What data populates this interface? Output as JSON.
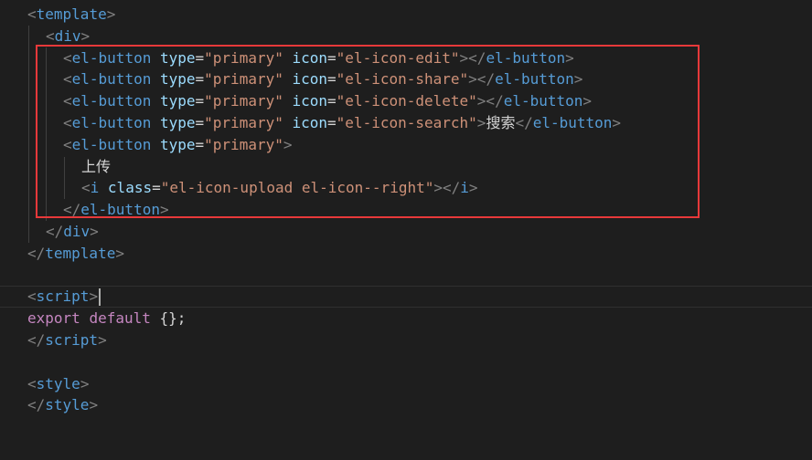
{
  "editor": {
    "lines": [
      {
        "tokens": [
          [
            "<",
            "b"
          ],
          [
            "template",
            "t"
          ],
          [
            ">",
            "b"
          ]
        ]
      },
      {
        "tokens": [
          [
            "<",
            "b"
          ],
          [
            "div",
            "t"
          ],
          [
            ">",
            "b"
          ]
        ]
      },
      {
        "tokens": [
          [
            "<",
            "b"
          ],
          [
            "el-button",
            "t"
          ],
          [
            " ",
            "x"
          ],
          [
            "type",
            "a"
          ],
          [
            "=",
            "e"
          ],
          [
            "\"primary\"",
            "s"
          ],
          [
            " ",
            "x"
          ],
          [
            "icon",
            "a"
          ],
          [
            "=",
            "e"
          ],
          [
            "\"el-icon-edit\"",
            "s"
          ],
          [
            "></",
            "b"
          ],
          [
            "el-button",
            "t"
          ],
          [
            ">",
            "b"
          ]
        ]
      },
      {
        "tokens": [
          [
            "<",
            "b"
          ],
          [
            "el-button",
            "t"
          ],
          [
            " ",
            "x"
          ],
          [
            "type",
            "a"
          ],
          [
            "=",
            "e"
          ],
          [
            "\"primary\"",
            "s"
          ],
          [
            " ",
            "x"
          ],
          [
            "icon",
            "a"
          ],
          [
            "=",
            "e"
          ],
          [
            "\"el-icon-share\"",
            "s"
          ],
          [
            "></",
            "b"
          ],
          [
            "el-button",
            "t"
          ],
          [
            ">",
            "b"
          ]
        ]
      },
      {
        "tokens": [
          [
            "<",
            "b"
          ],
          [
            "el-button",
            "t"
          ],
          [
            " ",
            "x"
          ],
          [
            "type",
            "a"
          ],
          [
            "=",
            "e"
          ],
          [
            "\"primary\"",
            "s"
          ],
          [
            " ",
            "x"
          ],
          [
            "icon",
            "a"
          ],
          [
            "=",
            "e"
          ],
          [
            "\"el-icon-delete\"",
            "s"
          ],
          [
            "></",
            "b"
          ],
          [
            "el-button",
            "t"
          ],
          [
            ">",
            "b"
          ]
        ]
      },
      {
        "tokens": [
          [
            "<",
            "b"
          ],
          [
            "el-button",
            "t"
          ],
          [
            " ",
            "x"
          ],
          [
            "type",
            "a"
          ],
          [
            "=",
            "e"
          ],
          [
            "\"primary\"",
            "s"
          ],
          [
            " ",
            "x"
          ],
          [
            "icon",
            "a"
          ],
          [
            "=",
            "e"
          ],
          [
            "\"el-icon-search\"",
            "s"
          ],
          [
            ">",
            "b"
          ],
          [
            "搜索",
            "x"
          ],
          [
            "</",
            "b"
          ],
          [
            "el-button",
            "t"
          ],
          [
            ">",
            "b"
          ]
        ]
      },
      {
        "tokens": [
          [
            "<",
            "b"
          ],
          [
            "el-button",
            "t"
          ],
          [
            " ",
            "x"
          ],
          [
            "type",
            "a"
          ],
          [
            "=",
            "e"
          ],
          [
            "\"primary\"",
            "s"
          ],
          [
            ">",
            "b"
          ]
        ]
      },
      {
        "tokens": [
          [
            "上传",
            "x"
          ]
        ]
      },
      {
        "tokens": [
          [
            "<",
            "b"
          ],
          [
            "i",
            "t"
          ],
          [
            " ",
            "x"
          ],
          [
            "class",
            "a"
          ],
          [
            "=",
            "e"
          ],
          [
            "\"el-icon-upload el-icon--right\"",
            "s"
          ],
          [
            "></",
            "b"
          ],
          [
            "i",
            "t"
          ],
          [
            ">",
            "b"
          ]
        ]
      },
      {
        "tokens": [
          [
            "</",
            "b"
          ],
          [
            "el-button",
            "t"
          ],
          [
            ">",
            "b"
          ]
        ]
      },
      {
        "tokens": [
          [
            "</",
            "b"
          ],
          [
            "div",
            "t"
          ],
          [
            ">",
            "b"
          ]
        ]
      },
      {
        "tokens": [
          [
            "</",
            "b"
          ],
          [
            "template",
            "t"
          ],
          [
            ">",
            "b"
          ]
        ]
      },
      {
        "tokens": []
      },
      {
        "tokens": [
          [
            "<",
            "b"
          ],
          [
            "script",
            "t"
          ],
          [
            ">",
            "b"
          ]
        ],
        "cursor": true
      },
      {
        "tokens": [
          [
            "export",
            "k"
          ],
          [
            " ",
            "x"
          ],
          [
            "default",
            "k"
          ],
          [
            " {};",
            "x"
          ]
        ]
      },
      {
        "tokens": [
          [
            "</",
            "b"
          ],
          [
            "script",
            "t"
          ],
          [
            ">",
            "b"
          ]
        ]
      },
      {
        "tokens": []
      },
      {
        "tokens": [
          [
            "<",
            "b"
          ],
          [
            "style",
            "t"
          ],
          [
            ">",
            "b"
          ]
        ]
      },
      {
        "tokens": [
          [
            "</",
            "b"
          ],
          [
            "style",
            "t"
          ],
          [
            ">",
            "b"
          ]
        ]
      }
    ]
  },
  "colors": {
    "background": "#1e1e1e",
    "highlight_box": "#e8393a",
    "tag": "#569cd6",
    "attribute": "#9cdcfe",
    "string": "#ce9178",
    "keyword": "#c586c0",
    "text": "#d4d4d4",
    "bracket": "#808080"
  }
}
